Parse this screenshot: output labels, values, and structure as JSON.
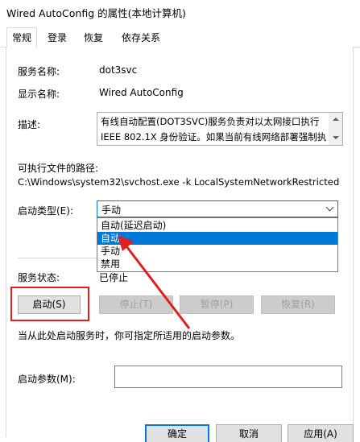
{
  "window": {
    "title": "Wired AutoConfig 的属性(本地计算机)"
  },
  "tabs": [
    {
      "label": "常规"
    },
    {
      "label": "登录"
    },
    {
      "label": "恢复"
    },
    {
      "label": "依存关系"
    }
  ],
  "general": {
    "service_name_label": "服务名称:",
    "service_name_value": "dot3svc",
    "display_name_label": "显示名称:",
    "display_name_value": "Wired AutoConfig",
    "description_label": "描述:",
    "description_value": "有线自动配置(DOT3SVC)服务负责对以太网接口执行 IEEE 802.1X 身份验证。如果当前有线网络部署强制执",
    "exe_path_label": "可执行文件的路径:",
    "exe_path_value": "C:\\Windows\\system32\\svchost.exe -k LocalSystemNetworkRestricted",
    "startup_type_label": "启动类型(E):",
    "startup_type_value": "手动",
    "startup_options": [
      "自动(延迟启动)",
      "自动",
      "手动",
      "禁用"
    ],
    "service_status_label": "服务状态:",
    "service_status_value": "已停止",
    "start_button": "启动(S)",
    "stop_button": "停止(T)",
    "pause_button": "暂停(P)",
    "resume_button": "恢复(R)",
    "hint_text": "当从此处启动服务时，你可指定所适用的启动参数。",
    "start_params_label": "启动参数(M):"
  },
  "footer": {
    "ok_button": "确定",
    "cancel_button": "取消",
    "apply_button": "应用(A)"
  },
  "colors": {
    "accent": "#0078d7",
    "annotation": "#e01f1f"
  }
}
